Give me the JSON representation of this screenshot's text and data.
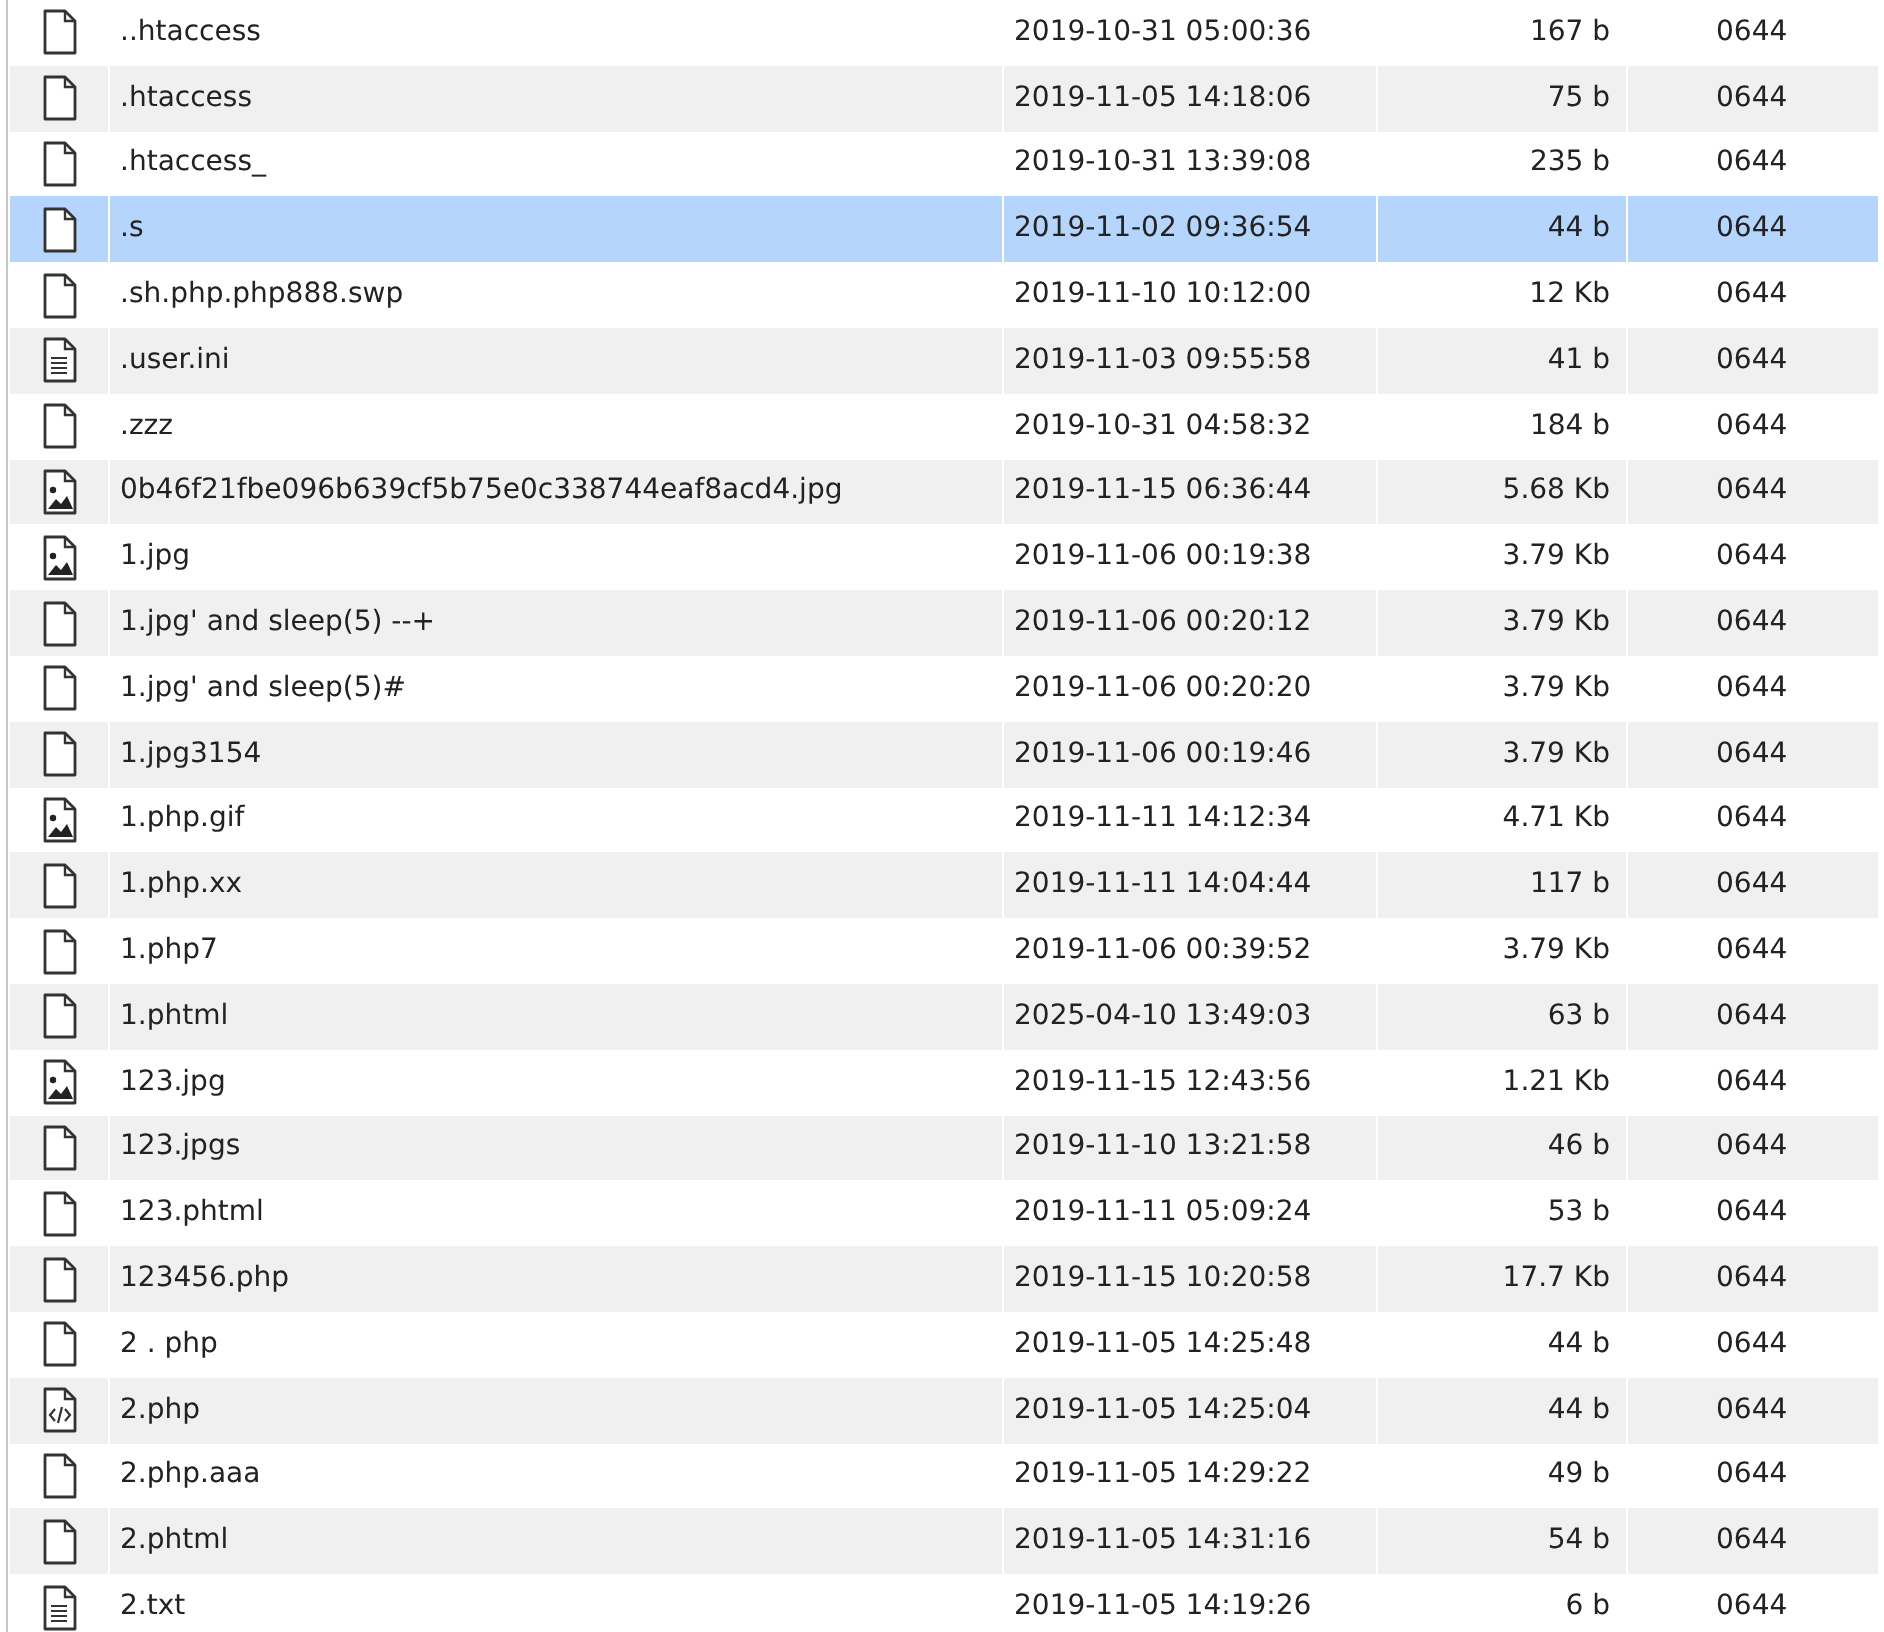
{
  "files": [
    {
      "kind": "file",
      "name": "..htaccess",
      "modified": "2019-10-31 05:00:36",
      "size": "167 b",
      "perms": "0644",
      "selected": false
    },
    {
      "kind": "file",
      "name": ".htaccess",
      "modified": "2019-11-05 14:18:06",
      "size": "75 b",
      "perms": "0644",
      "selected": false
    },
    {
      "kind": "file",
      "name": ".htaccess_",
      "modified": "2019-10-31 13:39:08",
      "size": "235 b",
      "perms": "0644",
      "selected": false
    },
    {
      "kind": "file",
      "name": ".s",
      "modified": "2019-11-02 09:36:54",
      "size": "44 b",
      "perms": "0644",
      "selected": true
    },
    {
      "kind": "file",
      "name": ".sh.php.php888.swp",
      "modified": "2019-11-10 10:12:00",
      "size": "12 Kb",
      "perms": "0644",
      "selected": false
    },
    {
      "kind": "text",
      "name": ".user.ini",
      "modified": "2019-11-03 09:55:58",
      "size": "41 b",
      "perms": "0644",
      "selected": false
    },
    {
      "kind": "file",
      "name": ".zzz",
      "modified": "2019-10-31 04:58:32",
      "size": "184 b",
      "perms": "0644",
      "selected": false
    },
    {
      "kind": "image",
      "name": "0b46f21fbe096b639cf5b75e0c338744eaf8acd4.jpg",
      "modified": "2019-11-15 06:36:44",
      "size": "5.68 Kb",
      "perms": "0644",
      "selected": false
    },
    {
      "kind": "image",
      "name": "1.jpg",
      "modified": "2019-11-06 00:19:38",
      "size": "3.79 Kb",
      "perms": "0644",
      "selected": false
    },
    {
      "kind": "file",
      "name": "1.jpg' and sleep(5) --+",
      "modified": "2019-11-06 00:20:12",
      "size": "3.79 Kb",
      "perms": "0644",
      "selected": false
    },
    {
      "kind": "file",
      "name": "1.jpg' and sleep(5)#",
      "modified": "2019-11-06 00:20:20",
      "size": "3.79 Kb",
      "perms": "0644",
      "selected": false
    },
    {
      "kind": "file",
      "name": "1.jpg3154",
      "modified": "2019-11-06 00:19:46",
      "size": "3.79 Kb",
      "perms": "0644",
      "selected": false
    },
    {
      "kind": "image",
      "name": "1.php.gif",
      "modified": "2019-11-11 14:12:34",
      "size": "4.71 Kb",
      "perms": "0644",
      "selected": false
    },
    {
      "kind": "file",
      "name": "1.php.xx",
      "modified": "2019-11-11 14:04:44",
      "size": "117 b",
      "perms": "0644",
      "selected": false
    },
    {
      "kind": "file",
      "name": "1.php7",
      "modified": "2019-11-06 00:39:52",
      "size": "3.79 Kb",
      "perms": "0644",
      "selected": false
    },
    {
      "kind": "file",
      "name": "1.phtml",
      "modified": "2025-04-10 13:49:03",
      "size": "63 b",
      "perms": "0644",
      "selected": false
    },
    {
      "kind": "image",
      "name": "123.jpg",
      "modified": "2019-11-15 12:43:56",
      "size": "1.21 Kb",
      "perms": "0644",
      "selected": false
    },
    {
      "kind": "file",
      "name": "123.jpgs",
      "modified": "2019-11-10 13:21:58",
      "size": "46 b",
      "perms": "0644",
      "selected": false
    },
    {
      "kind": "file",
      "name": "123.phtml",
      "modified": "2019-11-11 05:09:24",
      "size": "53 b",
      "perms": "0644",
      "selected": false
    },
    {
      "kind": "file",
      "name": "123456.php",
      "modified": "2019-11-15 10:20:58",
      "size": "17.7 Kb",
      "perms": "0644",
      "selected": false
    },
    {
      "kind": "file",
      "name": "2 . php",
      "modified": "2019-11-05 14:25:48",
      "size": "44 b",
      "perms": "0644",
      "selected": false
    },
    {
      "kind": "code",
      "name": "2.php",
      "modified": "2019-11-05 14:25:04",
      "size": "44 b",
      "perms": "0644",
      "selected": false
    },
    {
      "kind": "file",
      "name": "2.php.aaa",
      "modified": "2019-11-05 14:29:22",
      "size": "49 b",
      "perms": "0644",
      "selected": false
    },
    {
      "kind": "file",
      "name": "2.phtml",
      "modified": "2019-11-05 14:31:16",
      "size": "54 b",
      "perms": "0644",
      "selected": false
    },
    {
      "kind": "text",
      "name": "2.txt",
      "modified": "2019-11-05 14:19:26",
      "size": "6 b",
      "perms": "0644",
      "selected": false
    }
  ]
}
